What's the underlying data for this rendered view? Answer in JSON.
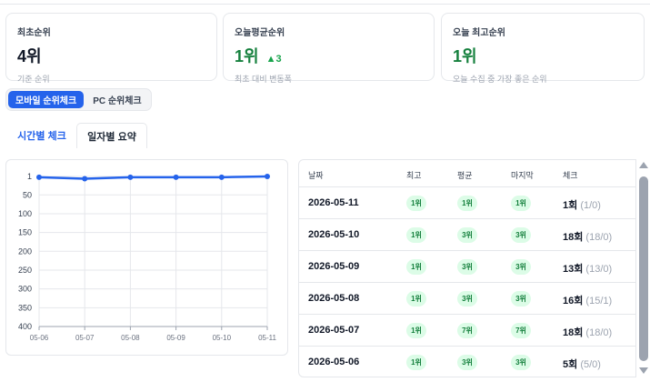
{
  "cards": [
    {
      "title": "최초순위",
      "value": "4위",
      "delta": "",
      "subtitle": "기준 순위",
      "color": "#111827"
    },
    {
      "title": "오늘평균순위",
      "value": "1위",
      "delta": "▲3",
      "subtitle": "최초 대비 변동폭",
      "color": "#15803d"
    },
    {
      "title": "오늘 최고순위",
      "value": "1위",
      "delta": "",
      "subtitle": "오늘 수집 중 가장 좋은 순위",
      "color": "#15803d"
    }
  ],
  "toggle": {
    "mobile": "모바일 순위체크",
    "pc": "PC 순위체크"
  },
  "tabs": {
    "hourly": "시간별 체크",
    "daily": "일자별 요약"
  },
  "table": {
    "headers": {
      "date": "날짜",
      "best": "최고",
      "avg": "평균",
      "last": "마지막",
      "checks": "체크"
    },
    "rows": [
      {
        "date": "2026-05-11",
        "best": "1위",
        "avg": "1위",
        "last": "1위",
        "count": "1회",
        "detail": "(1/0)"
      },
      {
        "date": "2026-05-10",
        "best": "1위",
        "avg": "3위",
        "last": "3위",
        "count": "18회",
        "detail": "(18/0)"
      },
      {
        "date": "2026-05-09",
        "best": "1위",
        "avg": "3위",
        "last": "3위",
        "count": "13회",
        "detail": "(13/0)"
      },
      {
        "date": "2026-05-08",
        "best": "1위",
        "avg": "3위",
        "last": "3위",
        "count": "16회",
        "detail": "(15/1)"
      },
      {
        "date": "2026-05-07",
        "best": "1위",
        "avg": "7위",
        "last": "7위",
        "count": "18회",
        "detail": "(18/0)"
      },
      {
        "date": "2026-05-06",
        "best": "1위",
        "avg": "3위",
        "last": "3위",
        "count": "5회",
        "detail": "(5/0)"
      }
    ]
  },
  "colors": {
    "accent": "#2563eb",
    "good": "#15803d",
    "pill_bg": "#dcfce7"
  },
  "chart_data": {
    "type": "line",
    "x": [
      "05-06",
      "05-07",
      "05-08",
      "05-09",
      "05-10",
      "05-11"
    ],
    "series": [
      {
        "values": [
          3,
          7,
          3,
          3,
          3,
          1
        ]
      }
    ],
    "y_ticks": [
      "1",
      "50",
      "100",
      "150",
      "200",
      "250",
      "300",
      "350",
      "400"
    ],
    "ylim": [
      1,
      400
    ],
    "y_inverted": true,
    "grid": true,
    "line_color": "#2563eb"
  }
}
